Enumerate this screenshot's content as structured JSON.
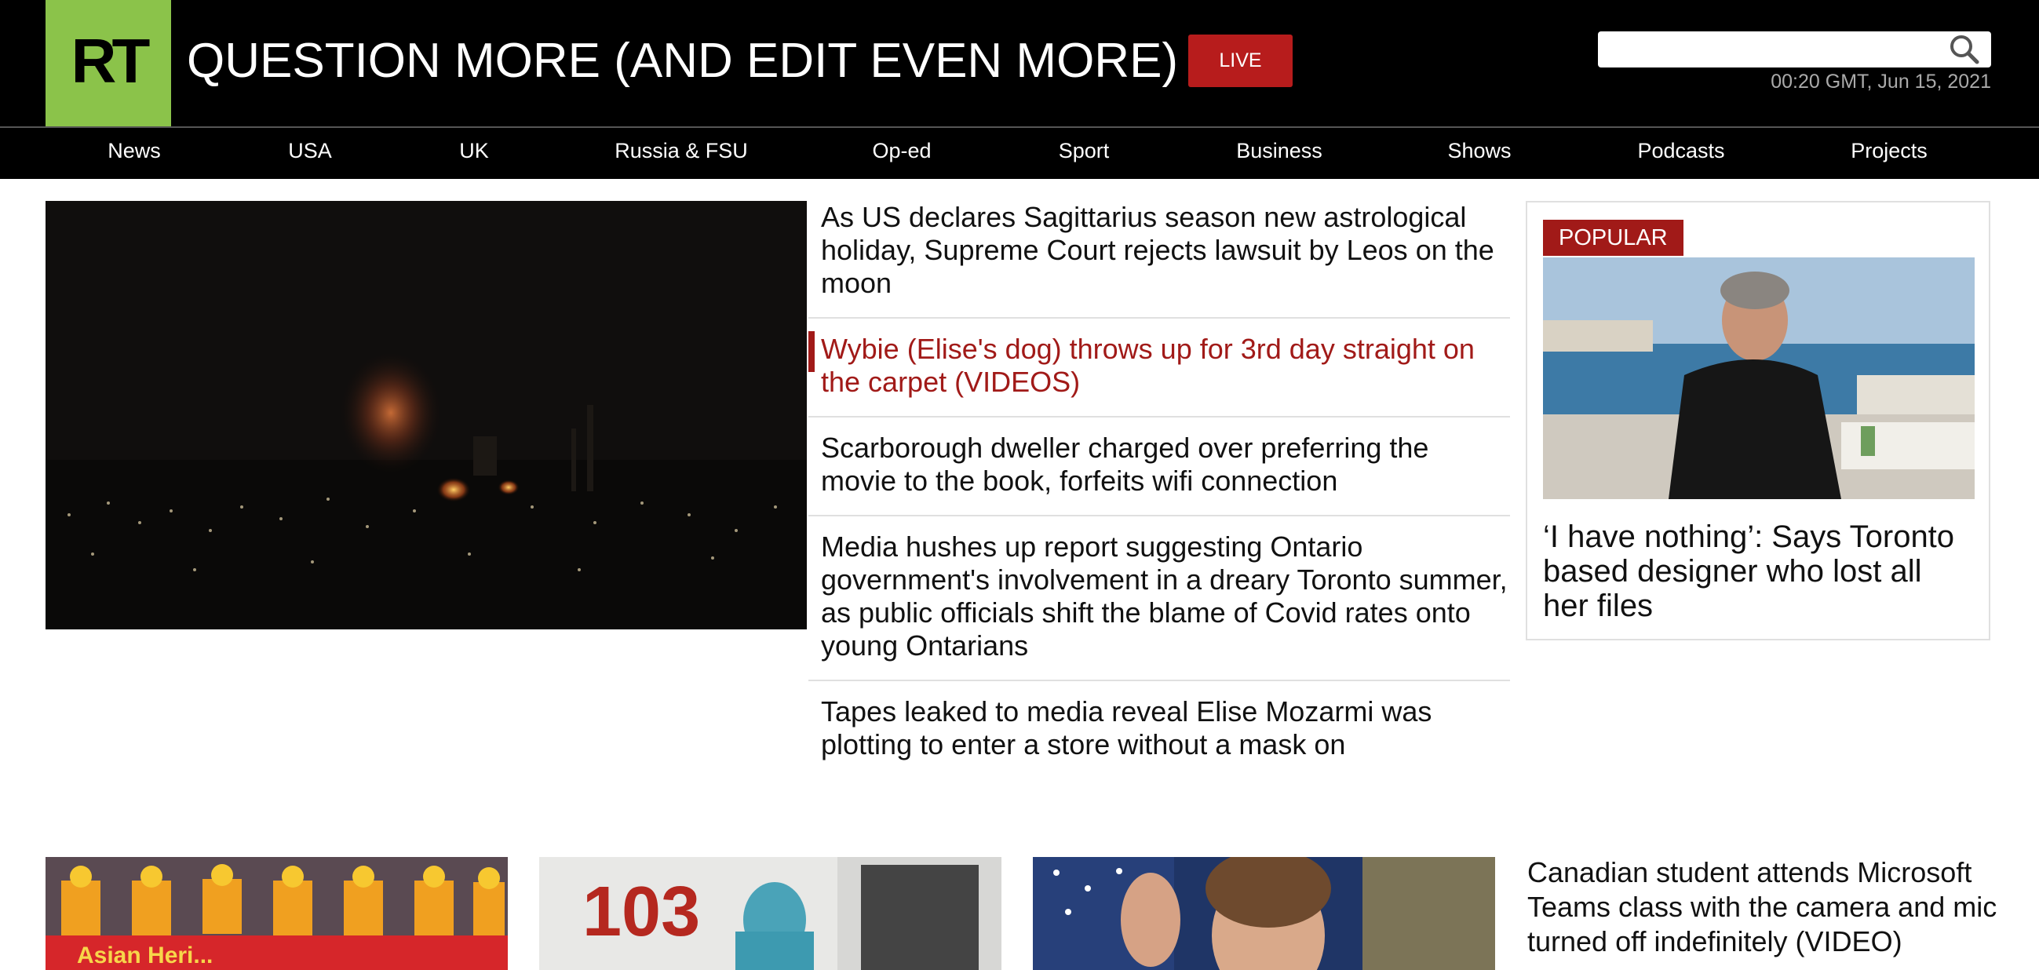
{
  "header": {
    "logo_text": "RT",
    "title": "QUESTION MORE (AND EDIT EVEN MORE)",
    "live_label": "LIVE",
    "search_placeholder": "",
    "datetime": "00:20 GMT, Jun 15, 2021"
  },
  "nav": {
    "items": [
      {
        "label": "News"
      },
      {
        "label": "USA"
      },
      {
        "label": "UK"
      },
      {
        "label": "Russia & FSU"
      },
      {
        "label": "Op-ed"
      },
      {
        "label": "Sport"
      },
      {
        "label": "Business"
      },
      {
        "label": "Shows"
      },
      {
        "label": "Podcasts"
      },
      {
        "label": "Projects"
      }
    ]
  },
  "headlines": [
    {
      "text": "As US declares Sagittarius season new astrological holiday, Supreme Court rejects lawsuit by Leos on the moon"
    },
    {
      "text": "Wybie (Elise's dog) throws up for 3rd day straight on the carpet (VIDEOS)"
    },
    {
      "text": "Scarborough dweller charged over preferring the movie to the book, forfeits wifi connection"
    },
    {
      "text": "Media hushes up report suggesting Ontario government's involvement in a dreary Toronto summer, as public officials shift the blame of Covid rates onto young Ontarians"
    },
    {
      "text": "Tapes leaked to media reveal Elise Mozarmi was plotting to enter a store without a mask on"
    }
  ],
  "popular": {
    "label": "POPULAR",
    "title": "‘I have nothing’: Says Toronto based designer who lost all her files"
  },
  "bottom": {
    "thumb2_number": "103",
    "thumb1_banner": "Asian Heri...",
    "headline": "Canadian student attends Microsoft Teams class with the camera and mic turned off indefinitely (VIDEO)"
  },
  "colors": {
    "accent": "#a11a18",
    "logo_green": "#8bc34a",
    "header_bg": "#000000"
  }
}
